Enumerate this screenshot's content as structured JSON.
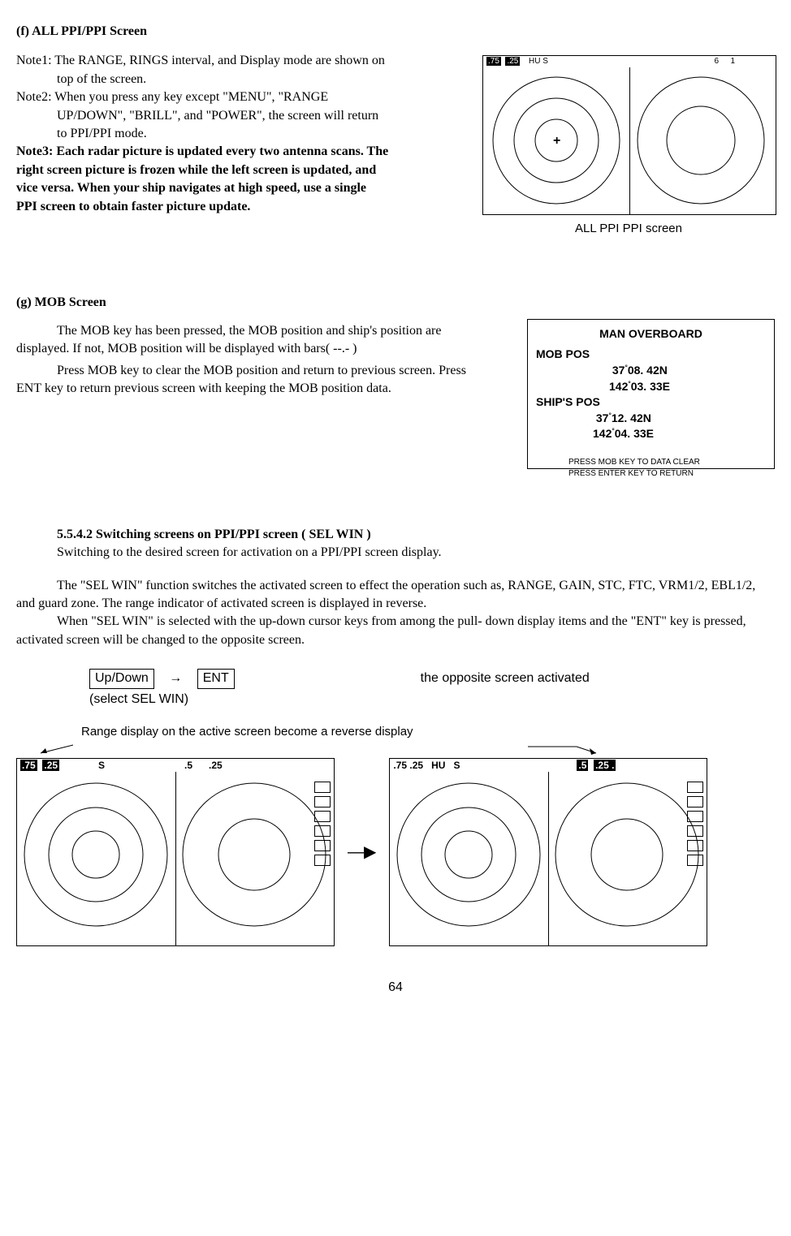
{
  "section_f": {
    "title": "(f) ALL PPI/PPI Screen",
    "note1_label": "Note1:",
    "note1_text1": " The RANGE, RINGS interval, and Display mode are shown on",
    "note1_text2": "top of the screen.",
    "note2_label": "Note2:",
    "note2_text1": " When you press any key except \"MENU\", \"RANGE",
    "note2_text2": "UP/DOWN\", \"BRILL\", and \"POWER\", the screen will return",
    "note2_text3": "to PPI/PPI mode.",
    "note3_text1": "Note3: Each radar picture is updated every two antenna scans. The",
    "note3_text2": "right screen picture is frozen while the left screen is updated, and",
    "note3_text3": "vice versa. When your ship navigates at high speed, use a single",
    "note3_text4": "PPI screen to obtain faster picture update.",
    "fig_caption": "ALL PPI PPI screen",
    "hdr_75": ".75",
    "hdr_25": ".25",
    "hdr_hus": "HU S",
    "hdr_6": "6",
    "hdr_1": "1",
    "plus": "+"
  },
  "section_g": {
    "title": "(g) MOB Screen",
    "para1": "The MOB key has been pressed, the MOB position and ship's position are displayed. If not, MOB position will be displayed with bars( --.- )",
    "para2": "Press MOB key to clear the MOB position and return to previous screen. Press ENT key to return previous screen with keeping the MOB position data.",
    "mob_title": "MAN  OVERBOARD",
    "mob_pos_label": "MOB  POS",
    "mob_lat": " 37°08. 42N",
    "mob_lon": "142°03. 33E",
    "ship_pos_label": "SHIP'S  POS",
    "ship_lat": " 37°12. 42N",
    "ship_lon": "142°04. 33E",
    "foot1": "PRESS MOB KEY TO DATA CLEAR",
    "foot2": "PRESS ENTER KEY TO RETURN"
  },
  "section_5542": {
    "title": "5.5.4.2 Switching screens on PPI/PPI screen ( SEL WIN )",
    "line1": "Switching to the desired screen for activation on a PPI/PPI screen display.",
    "line2": "The \"SEL WIN\" function switches the activated screen to effect the operation such as, RANGE, GAIN, STC, FTC, VRM1/2, EBL1/2, and guard zone. The range indicator of activated screen is displayed in reverse.",
    "line3": "When \"SEL WIN\" is selected with the up-down cursor keys from among the pull- down display items and the \"ENT\" key is pressed, activated screen will be changed to the opposite screen.",
    "btn_updown": "Up/Down",
    "btn_ent": "ENT",
    "arrow": "→",
    "result_text": "the opposite screen activated",
    "select_text": "(select SEL WIN)",
    "caption": "Range display on the active screen become a reverse display",
    "left_hdr_75": ".75",
    "left_hdr_25": ".25",
    "left_hdr_s": "S",
    "left_hdr_5": ".5",
    "left_hdr_25b": ".25",
    "right_hdr_7525": ".75 .25",
    "right_hdr_hu": "HU",
    "right_hdr_s": "S",
    "right_hdr_5": ".5",
    "right_hdr_25": ".25 ."
  },
  "page_number": "64"
}
